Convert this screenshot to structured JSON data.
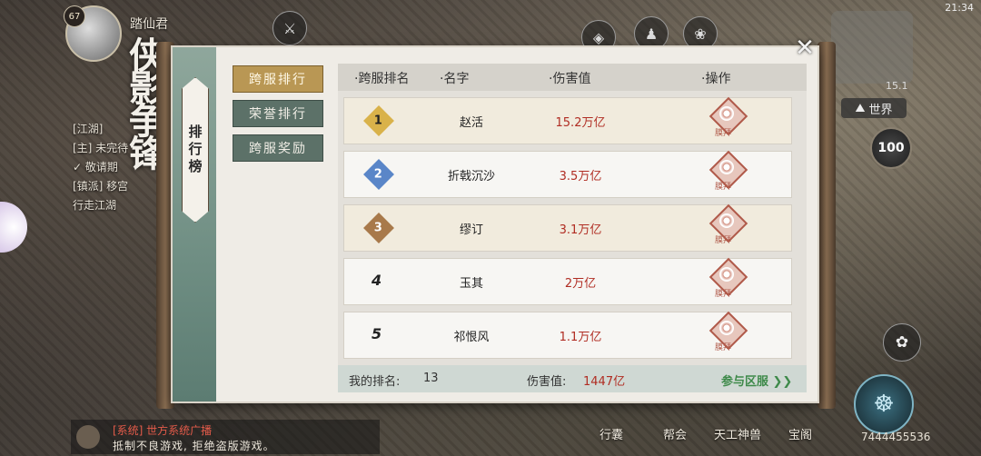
{
  "hud": {
    "player_name": "踏仙君",
    "level": "67",
    "big_title": "侠影争锋",
    "left_lines": [
      "[江湖]",
      "[主] 未完待",
      "✓ 敬请期",
      "[镇派] 移宫",
      "行走江湖"
    ],
    "time": "21:34",
    "world_label": "世界",
    "minimap_num": "15.1",
    "badge_100": "100",
    "badge_sub": "世界",
    "bottom_nav": [
      "行囊",
      "帮会",
      "天工神兽",
      "宝阁"
    ],
    "uid": "7444455536",
    "chat_line1": "[系统] 世方系统广播",
    "chat_line2": "抵制不良游戏, 拒绝盗版游戏。"
  },
  "panel": {
    "side_tag": "排行榜",
    "tabs": [
      {
        "label": "跨服排行",
        "active": true
      },
      {
        "label": "荣誉排行",
        "active": false
      },
      {
        "label": "跨服奖励",
        "active": false
      }
    ],
    "headers": {
      "rank": "·跨服排名",
      "name": "·名字",
      "damage": "·伤害值",
      "action": "·操作"
    },
    "rows": [
      {
        "rank": "1",
        "name": "赵活",
        "damage": "15.2万亿",
        "action": "膜拜",
        "medal_color": "#d9b24a"
      },
      {
        "rank": "2",
        "name": "折戟沉沙",
        "damage": "3.5万亿",
        "action": "膜拜",
        "medal_color": "#5a86c8"
      },
      {
        "rank": "3",
        "name": "缪订",
        "damage": "3.1万亿",
        "action": "膜拜",
        "medal_color": "#a8794a"
      },
      {
        "rank": "4",
        "name": "玉其",
        "damage": "2万亿",
        "action": "膜拜"
      },
      {
        "rank": "5",
        "name": "祁恨风",
        "damage": "1.1万亿",
        "action": "膜拜"
      }
    ],
    "footer": {
      "my_rank_label": "我的排名:",
      "my_rank_value": "13",
      "damage_label": "伤害值:",
      "damage_value": "1447亿",
      "join_label": "参与区服 ❯❯"
    }
  }
}
